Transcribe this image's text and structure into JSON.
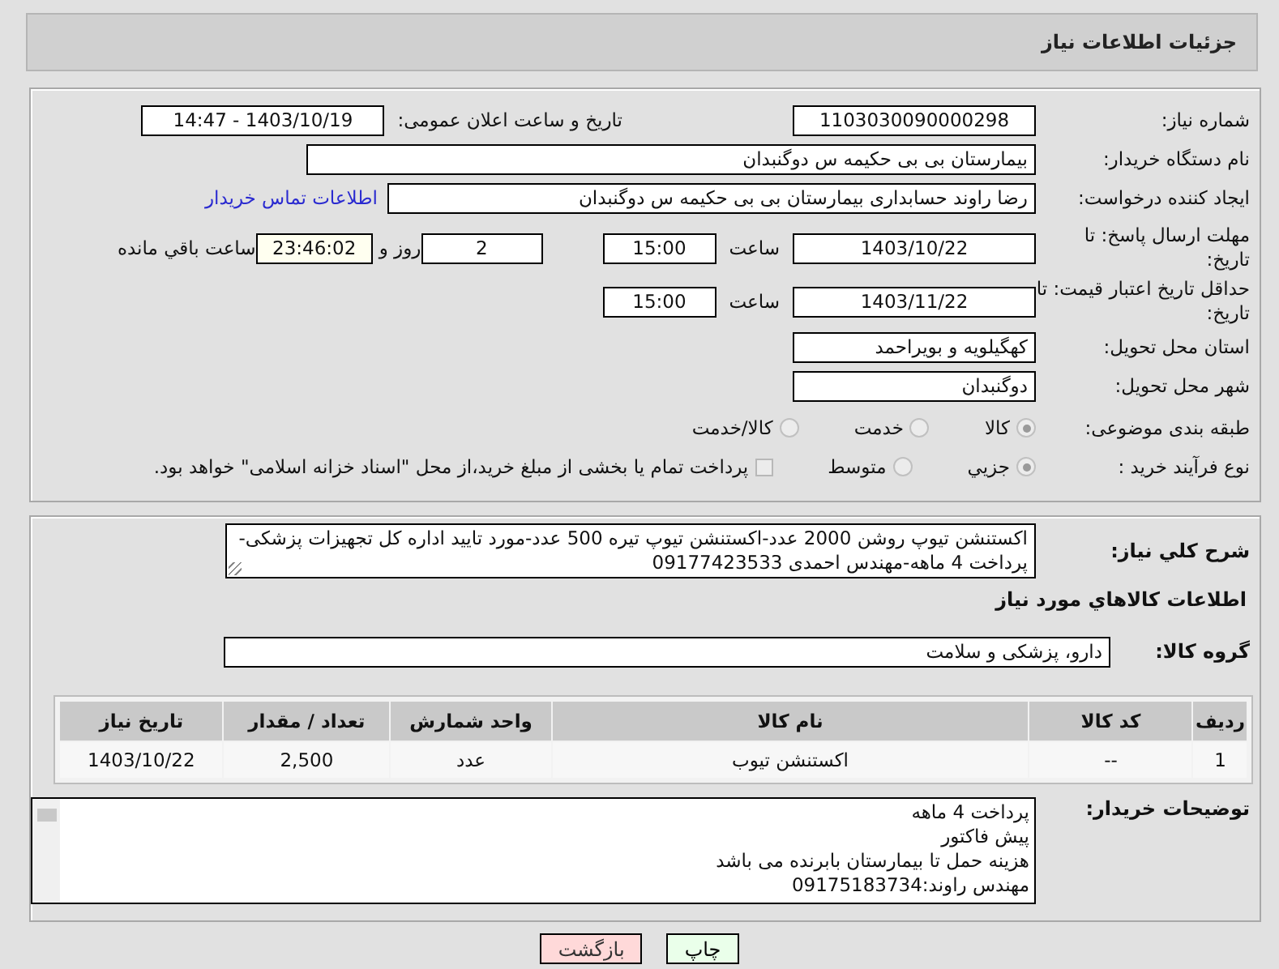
{
  "header": {
    "title": "جزئیات اطلاعات نیاز"
  },
  "need_number": {
    "label": "شماره نیاز:",
    "value": "1103030090000298"
  },
  "announce": {
    "label": "تاریخ و ساعت اعلان عمومی:",
    "value": "1403/10/19 - 14:47"
  },
  "buyer_org": {
    "label": "نام دستگاه خریدار:",
    "value": "بیمارستان بی بی حکیمه س  دوگنبدان"
  },
  "creator": {
    "label": "ایجاد کننده درخواست:",
    "value": "رضا راوند حسابداری بیمارستان بی بی حکیمه س  دوگنبدان",
    "link": "اطلاعات تماس خریدار"
  },
  "reply_deadline": {
    "label": "مهلت ارسال پاسخ: تا تاریخ:",
    "date": "1403/10/22",
    "time_label": "ساعت",
    "time": "15:00",
    "days": "2",
    "days_label": "روز و",
    "remaining": "23:46:02",
    "remaining_label": "ساعت باقي مانده"
  },
  "price_validity": {
    "label": "حداقل تاریخ اعتبار قیمت: تا تاریخ:",
    "date": "1403/11/22",
    "time_label": "ساعت",
    "time": "15:00"
  },
  "province": {
    "label": "استان محل تحویل:",
    "value": "کهگیلویه و بویراحمد"
  },
  "city": {
    "label": "شهر محل تحویل:",
    "value": "دوگنبدان"
  },
  "category": {
    "label": "طبقه بندی موضوعی:",
    "options": [
      {
        "label": "کالا",
        "selected": true
      },
      {
        "label": "خدمت",
        "selected": false
      },
      {
        "label": "کالا/خدمت",
        "selected": false
      }
    ]
  },
  "process": {
    "label": "نوع فرآیند خرید :",
    "options": [
      {
        "label": "جزیي",
        "selected": true
      },
      {
        "label": "متوسط",
        "selected": false
      }
    ],
    "treasury": {
      "label": "پرداخت تمام یا بخشی از مبلغ خرید،از محل \"اسناد خزانه اسلامی\" خواهد بود.",
      "checked": false
    }
  },
  "description": {
    "label": "شرح کلي نياز:",
    "value": "اکستنشن تیوپ روشن 2000 عدد-اکستنشن تیوپ تیره 500 عدد-مورد تایید اداره کل تجهیزات پزشکی-پرداخت 4 ماهه-مهندس احمدی 09177423533"
  },
  "goods": {
    "heading": "اطلاعات کالاهاي مورد نياز",
    "group_label": "گروه کالا:",
    "group": "دارو، پزشکی و سلامت"
  },
  "table": {
    "columns": [
      "ردیف",
      "کد کالا",
      "نام کالا",
      "واحد شمارش",
      "تعداد / مقدار",
      "تاریخ نیاز"
    ],
    "rows": [
      [
        "1",
        "--",
        "اکستنشن تیوب",
        "عدد",
        "2,500",
        "1403/10/22"
      ]
    ]
  },
  "buyer_notes": {
    "label": "توضیحات خریدار:",
    "lines": [
      "پرداخت 4 ماهه",
      "پیش فاکتور",
      "هزینه حمل تا بیمارستان بابرنده می باشد",
      "مهندس راوند:09175183734"
    ]
  },
  "buttons": [
    {
      "label": "چاپ",
      "kind": "print"
    },
    {
      "label": "بازگشت",
      "kind": "back"
    }
  ]
}
